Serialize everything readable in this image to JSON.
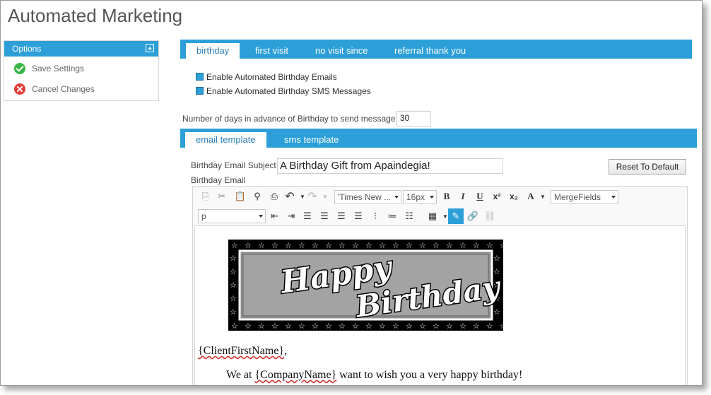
{
  "page": {
    "title": "Automated Marketing"
  },
  "options": {
    "header": "Options",
    "items": [
      {
        "label": "Save Settings",
        "icon": "check-icon"
      },
      {
        "label": "Cancel Changes",
        "icon": "x-icon"
      }
    ]
  },
  "main_tabs": [
    "birthday",
    "first visit",
    "no visit since",
    "referral thank you"
  ],
  "settings": {
    "enable_email_label": "Enable Automated Birthday Emails",
    "enable_sms_label": "Enable Automated Birthday SMS Messages",
    "days_label": "Number of days in advance of Birthday to send message",
    "days_value": "30"
  },
  "template_tabs": [
    "email template",
    "sms template"
  ],
  "email": {
    "subject_label": "Birthday Email Subject",
    "subject_value": "A Birthday Gift from Apaindegia!",
    "reset_label": "Reset To Default",
    "body_label": "Birthday Email"
  },
  "toolbar": {
    "font_name": "'Times New ...",
    "font_size": "16px",
    "merge_fields": "MergeFields",
    "paragraph": "p"
  },
  "content": {
    "banner_text_1": "Happy",
    "banner_text_2": "Birthday",
    "line1_field": "{ClientFirstName}",
    "line1_suffix": ",",
    "line2_prefix": "We at ",
    "line2_field": "{CompanyName}",
    "line2_suffix": " want to wish you a very happy birthday!"
  },
  "colors": {
    "accent": "#2c9fd8",
    "ok": "#3bb54a",
    "cancel": "#e0403a"
  }
}
